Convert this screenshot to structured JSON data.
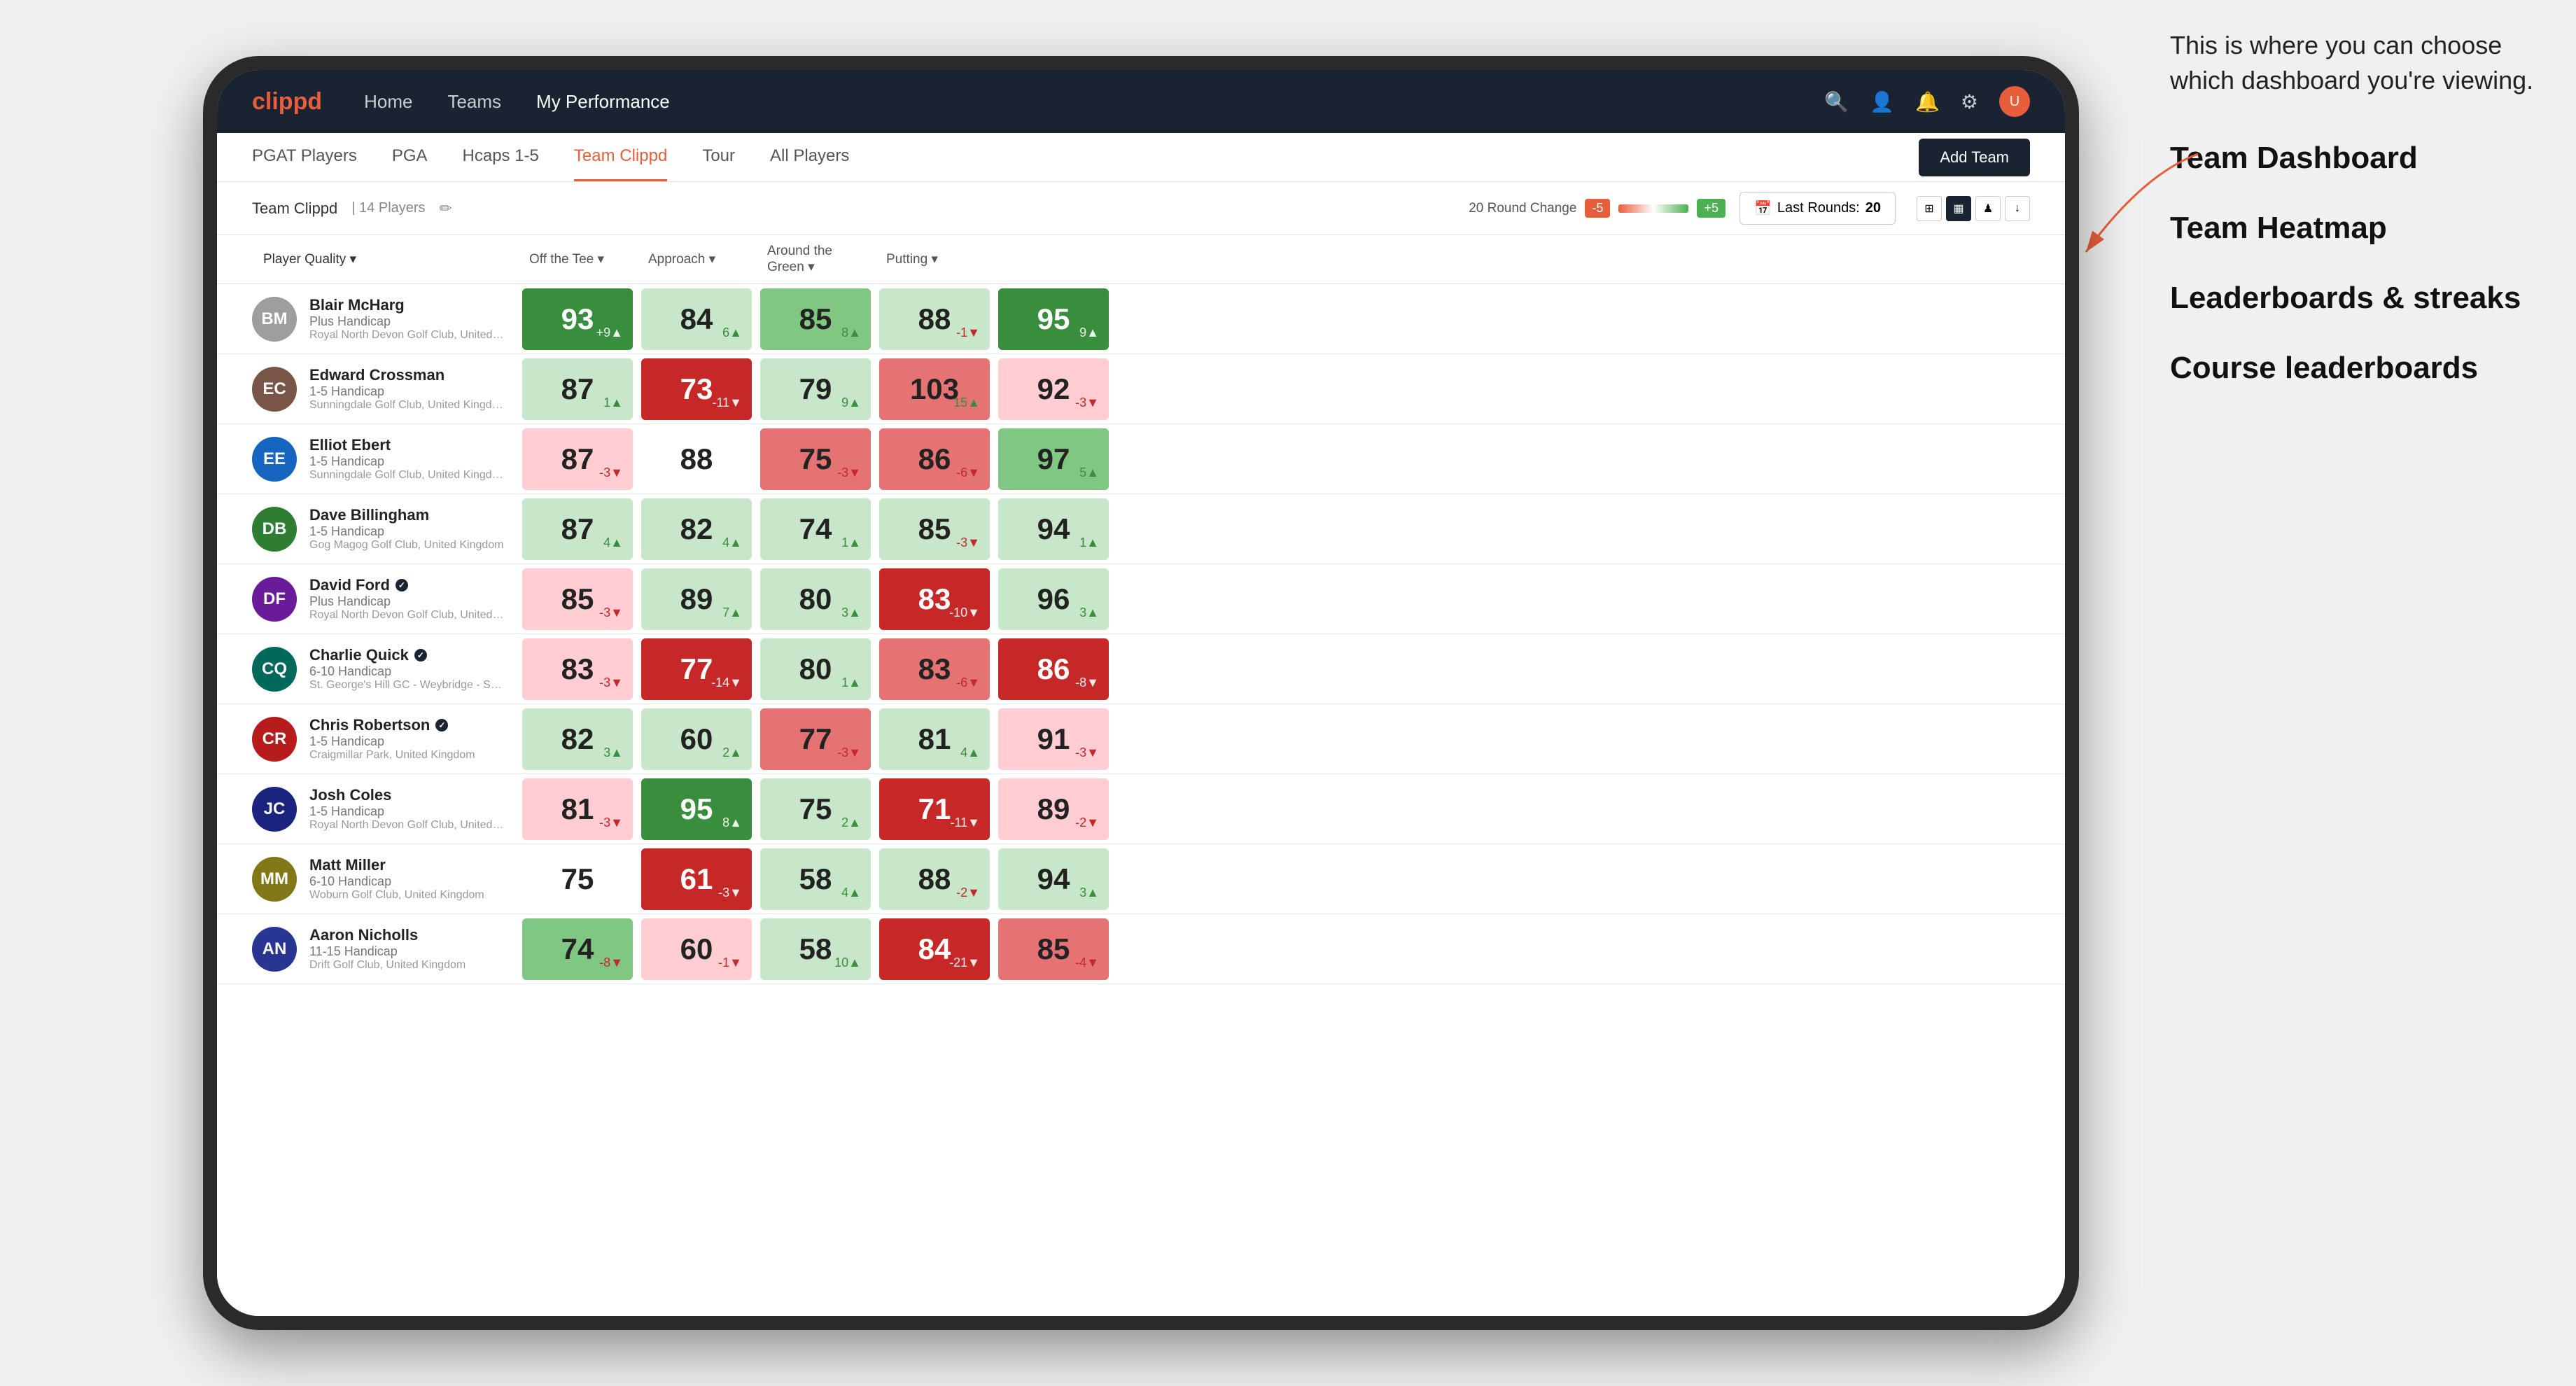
{
  "annotation": {
    "callout": "This is where you can choose which dashboard you're viewing.",
    "items": [
      "Team Dashboard",
      "Team Heatmap",
      "Leaderboards & streaks",
      "Course leaderboards"
    ]
  },
  "nav": {
    "logo": "clippd",
    "links": [
      {
        "label": "Home",
        "active": false
      },
      {
        "label": "Teams",
        "active": false
      },
      {
        "label": "My Performance",
        "active": true
      }
    ],
    "icons": {
      "search": "🔍",
      "profile": "👤",
      "bell": "🔔",
      "settings": "⚙",
      "avatar": "👤"
    }
  },
  "subnav": {
    "links": [
      {
        "label": "PGAT Players",
        "active": false
      },
      {
        "label": "PGA",
        "active": false
      },
      {
        "label": "Hcaps 1-5",
        "active": false
      },
      {
        "label": "Team Clippd",
        "active": true
      },
      {
        "label": "Tour",
        "active": false
      },
      {
        "label": "All Players",
        "active": false
      }
    ],
    "add_team_label": "Add Team"
  },
  "team_header": {
    "name": "Team Clippd",
    "separator": "|",
    "count": "14 Players",
    "round_change_label": "20 Round Change",
    "neg": "-5",
    "pos": "+5",
    "last_rounds_label": "Last Rounds:",
    "last_rounds_value": "20",
    "view_icons": [
      "⊞",
      "▦",
      "♟",
      "↓"
    ]
  },
  "table": {
    "columns": [
      {
        "label": "Player Quality ▾",
        "key": "player_quality"
      },
      {
        "label": "Off the Tee ▾",
        "key": "off_tee"
      },
      {
        "label": "Approach ▾",
        "key": "approach"
      },
      {
        "label": "Around the Green ▾",
        "key": "around_green"
      },
      {
        "label": "Putting ▾",
        "key": "putting"
      }
    ],
    "players": [
      {
        "name": "Blair McHarg",
        "hcap": "Plus Handicap",
        "club": "Royal North Devon Golf Club, United Kingdom",
        "avatar_initials": "BM",
        "avatar_color": "av-gray",
        "verified": false,
        "scores": [
          {
            "value": 93,
            "change": "+9",
            "direction": "up",
            "color": "cell-green-dark"
          },
          {
            "value": 84,
            "change": "6",
            "direction": "up",
            "color": "cell-green-light"
          },
          {
            "value": 85,
            "change": "8",
            "direction": "up",
            "color": "cell-green-mid"
          },
          {
            "value": 88,
            "change": "-1",
            "direction": "down",
            "color": "cell-green-light"
          },
          {
            "value": 95,
            "change": "9",
            "direction": "up",
            "color": "cell-green-dark"
          }
        ]
      },
      {
        "name": "Edward Crossman",
        "hcap": "1-5 Handicap",
        "club": "Sunningdale Golf Club, United Kingdom",
        "avatar_initials": "EC",
        "avatar_color": "av-brown",
        "verified": false,
        "scores": [
          {
            "value": 87,
            "change": "1",
            "direction": "up",
            "color": "cell-green-light"
          },
          {
            "value": 73,
            "change": "-11",
            "direction": "down",
            "color": "cell-red-dark"
          },
          {
            "value": 79,
            "change": "9",
            "direction": "up",
            "color": "cell-green-light"
          },
          {
            "value": 103,
            "change": "15",
            "direction": "up",
            "color": "cell-red-mid"
          },
          {
            "value": 92,
            "change": "-3",
            "direction": "down",
            "color": "cell-red-light"
          }
        ]
      },
      {
        "name": "Elliot Ebert",
        "hcap": "1-5 Handicap",
        "club": "Sunningdale Golf Club, United Kingdom",
        "avatar_initials": "EE",
        "avatar_color": "av-blue",
        "verified": false,
        "scores": [
          {
            "value": 87,
            "change": "-3",
            "direction": "down",
            "color": "cell-red-light"
          },
          {
            "value": 88,
            "change": "",
            "direction": "none",
            "color": "cell-white"
          },
          {
            "value": 75,
            "change": "-3",
            "direction": "down",
            "color": "cell-red-mid"
          },
          {
            "value": 86,
            "change": "-6",
            "direction": "down",
            "color": "cell-red-mid"
          },
          {
            "value": 97,
            "change": "5",
            "direction": "up",
            "color": "cell-green-mid"
          }
        ]
      },
      {
        "name": "Dave Billingham",
        "hcap": "1-5 Handicap",
        "club": "Gog Magog Golf Club, United Kingdom",
        "avatar_initials": "DB",
        "avatar_color": "av-green",
        "verified": false,
        "scores": [
          {
            "value": 87,
            "change": "4",
            "direction": "up",
            "color": "cell-green-light"
          },
          {
            "value": 82,
            "change": "4",
            "direction": "up",
            "color": "cell-green-light"
          },
          {
            "value": 74,
            "change": "1",
            "direction": "up",
            "color": "cell-green-light"
          },
          {
            "value": 85,
            "change": "-3",
            "direction": "down",
            "color": "cell-green-light"
          },
          {
            "value": 94,
            "change": "1",
            "direction": "up",
            "color": "cell-green-light"
          }
        ]
      },
      {
        "name": "David Ford",
        "hcap": "Plus Handicap",
        "club": "Royal North Devon Golf Club, United Kingdom",
        "avatar_initials": "DF",
        "avatar_color": "av-purple",
        "verified": true,
        "scores": [
          {
            "value": 85,
            "change": "-3",
            "direction": "down",
            "color": "cell-red-light"
          },
          {
            "value": 89,
            "change": "7",
            "direction": "up",
            "color": "cell-green-light"
          },
          {
            "value": 80,
            "change": "3",
            "direction": "up",
            "color": "cell-green-light"
          },
          {
            "value": 83,
            "change": "-10",
            "direction": "down",
            "color": "cell-red-dark"
          },
          {
            "value": 96,
            "change": "3",
            "direction": "up",
            "color": "cell-green-light"
          }
        ]
      },
      {
        "name": "Charlie Quick",
        "hcap": "6-10 Handicap",
        "club": "St. George's Hill GC - Weybridge - Surrey, Uni...",
        "avatar_initials": "CQ",
        "avatar_color": "av-teal",
        "verified": true,
        "scores": [
          {
            "value": 83,
            "change": "-3",
            "direction": "down",
            "color": "cell-red-light"
          },
          {
            "value": 77,
            "change": "-14",
            "direction": "down",
            "color": "cell-red-dark"
          },
          {
            "value": 80,
            "change": "1",
            "direction": "up",
            "color": "cell-green-light"
          },
          {
            "value": 83,
            "change": "-6",
            "direction": "down",
            "color": "cell-red-mid"
          },
          {
            "value": 86,
            "change": "-8",
            "direction": "down",
            "color": "cell-red-dark"
          }
        ]
      },
      {
        "name": "Chris Robertson",
        "hcap": "1-5 Handicap",
        "club": "Craigmillar Park, United Kingdom",
        "avatar_initials": "CR",
        "avatar_color": "av-red",
        "verified": true,
        "scores": [
          {
            "value": 82,
            "change": "3",
            "direction": "up",
            "color": "cell-green-light"
          },
          {
            "value": 60,
            "change": "2",
            "direction": "up",
            "color": "cell-green-light"
          },
          {
            "value": 77,
            "change": "-3",
            "direction": "down",
            "color": "cell-red-mid"
          },
          {
            "value": 81,
            "change": "4",
            "direction": "up",
            "color": "cell-green-light"
          },
          {
            "value": 91,
            "change": "-3",
            "direction": "down",
            "color": "cell-red-light"
          }
        ]
      },
      {
        "name": "Josh Coles",
        "hcap": "1-5 Handicap",
        "club": "Royal North Devon Golf Club, United Kingdom",
        "avatar_initials": "JC",
        "avatar_color": "av-navy",
        "verified": false,
        "scores": [
          {
            "value": 81,
            "change": "-3",
            "direction": "down",
            "color": "cell-red-light"
          },
          {
            "value": 95,
            "change": "8",
            "direction": "up",
            "color": "cell-green-dark"
          },
          {
            "value": 75,
            "change": "2",
            "direction": "up",
            "color": "cell-green-light"
          },
          {
            "value": 71,
            "change": "-11",
            "direction": "down",
            "color": "cell-red-dark"
          },
          {
            "value": 89,
            "change": "-2",
            "direction": "down",
            "color": "cell-red-light"
          }
        ]
      },
      {
        "name": "Matt Miller",
        "hcap": "6-10 Handicap",
        "club": "Woburn Golf Club, United Kingdom",
        "avatar_initials": "MM",
        "avatar_color": "av-olive",
        "verified": false,
        "scores": [
          {
            "value": 75,
            "change": "",
            "direction": "none",
            "color": "cell-white"
          },
          {
            "value": 61,
            "change": "-3",
            "direction": "down",
            "color": "cell-red-dark"
          },
          {
            "value": 58,
            "change": "4",
            "direction": "up",
            "color": "cell-green-light"
          },
          {
            "value": 88,
            "change": "-2",
            "direction": "down",
            "color": "cell-green-light"
          },
          {
            "value": 94,
            "change": "3",
            "direction": "up",
            "color": "cell-green-light"
          }
        ]
      },
      {
        "name": "Aaron Nicholls",
        "hcap": "11-15 Handicap",
        "club": "Drift Golf Club, United Kingdom",
        "avatar_initials": "AN",
        "avatar_color": "av-indigo",
        "verified": false,
        "scores": [
          {
            "value": 74,
            "change": "-8",
            "direction": "down",
            "color": "cell-green-mid"
          },
          {
            "value": 60,
            "change": "-1",
            "direction": "down",
            "color": "cell-red-light"
          },
          {
            "value": 58,
            "change": "10",
            "direction": "up",
            "color": "cell-green-light"
          },
          {
            "value": 84,
            "change": "-21",
            "direction": "down",
            "color": "cell-red-dark"
          },
          {
            "value": 85,
            "change": "-4",
            "direction": "down",
            "color": "cell-red-mid"
          }
        ]
      }
    ]
  }
}
